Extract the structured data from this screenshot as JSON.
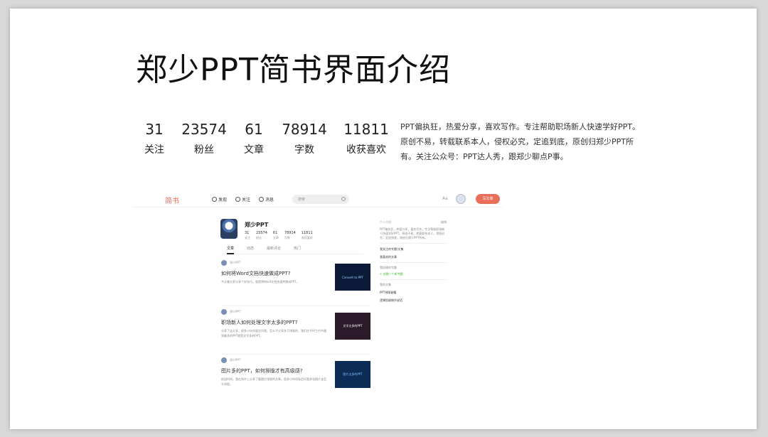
{
  "slide": {
    "title": "郑少PPT简书界面介绍",
    "stats": [
      {
        "value": "31",
        "label": "关注"
      },
      {
        "value": "23574",
        "label": "粉丝"
      },
      {
        "value": "61",
        "label": "文章"
      },
      {
        "value": "78914",
        "label": "字数"
      },
      {
        "value": "11811",
        "label": "收获喜欢"
      }
    ],
    "bio": "PPT偏执狂，热爱分享，喜欢写作。专注帮助职场新人快速学好PPT。原创不易，转载联系本人，侵权必究，定追到底，原创归郑少PPT所有。关注公众号：PPT达人秀，跟郑少聊点P事。"
  },
  "screenshot": {
    "logo": "简书",
    "nav": {
      "discover": "发现",
      "follow": "关注",
      "message": "消息",
      "search_placeholder": "搜索",
      "aa": "Aa",
      "write": "写文章"
    },
    "profile": {
      "name": "郑少PPT",
      "stats": [
        {
          "value": "31",
          "label": "关注"
        },
        {
          "value": "23574",
          "label": "粉丝"
        },
        {
          "value": "61",
          "label": "文章"
        },
        {
          "value": "78914",
          "label": "字数"
        },
        {
          "value": "11811",
          "label": "收获喜欢"
        }
      ]
    },
    "tabs": [
      "文章",
      "动态",
      "最新评论",
      "热门"
    ],
    "articles": [
      {
        "meta": "郑少PPT",
        "title": "如何将Word文档快速做成PPT?",
        "body": "今天聊大家分享个好技巧，就是将Word文档快速转换成PPT。",
        "thumb": "Convert to PPT"
      },
      {
        "meta": "郑少PPT",
        "title": "职场新人如何处理文字太多的PPT?",
        "body": "分享了这么多，很多小伙伴留言问我，怎么不分享关于排版的，我们在平时工作中遇到最多的PPT就是文字多的PPT。",
        "thumb": "文字太多的PPT"
      },
      {
        "meta": "郑少PPT",
        "title": "图片多的PPT，如何排版才有高级感?",
        "body": "前段时间，我在知乎上分享了篇图片排版的文章，很多小伙伴私信问我多张图片该怎么排版。",
        "thumb": "图片太多的PPT"
      }
    ],
    "side": {
      "intro_head": "个人介绍",
      "edit": "编辑",
      "intro": "PPT偏执狂，热爱分享，喜欢写作。专注帮助职场新人快速学好PPT。原创不易，转载联系本人，侵权必究，定追到底，原创归郑少PPT所有。",
      "liked_articles": "我关注的专题/文集",
      "liked": "我喜欢的文章",
      "collections_head": "我创建的专题",
      "new_collection": "+ 创建一个新专题",
      "books_head": "我的文集",
      "book1": "PPT排版秘籍",
      "book2": "逻辑思维制作说话"
    }
  }
}
